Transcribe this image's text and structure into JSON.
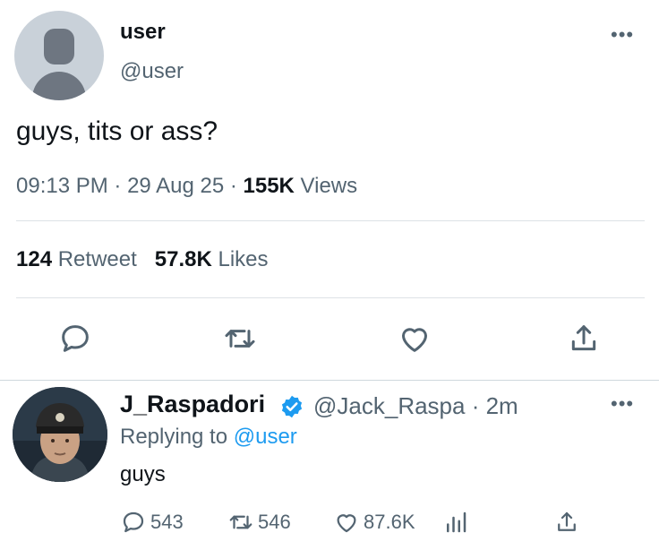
{
  "tweet": {
    "display_name": "user",
    "handle": "@user",
    "more_label": "•••",
    "text": "guys, tits or ass?",
    "time": "09:13 PM",
    "sep1": " · ",
    "date": "29 Aug 25",
    "sep2": " · ",
    "views_count": "155K",
    "views_label": " Views",
    "retweets_count": "124",
    "retweets_label": " Retweet",
    "likes_count": "57.8K",
    "likes_label": " Likes",
    "actions": [
      "reply-icon",
      "retweet-icon",
      "like-icon",
      "share-icon"
    ]
  },
  "reply": {
    "display_name": "J_Raspadori",
    "handle_time": "@Jack_Raspa · 2m",
    "replying_prefix": "Replying to ",
    "replying_mention": "@user",
    "text": "guys",
    "more_label": "•••",
    "replies": "543",
    "retweets": "546",
    "likes": "87.6K",
    "verified_color": "#1d9bf0"
  },
  "colors": {
    "text": "#0f1419",
    "secondary": "#536471",
    "link": "#1d9bf0",
    "divider": "#dde2e6"
  }
}
